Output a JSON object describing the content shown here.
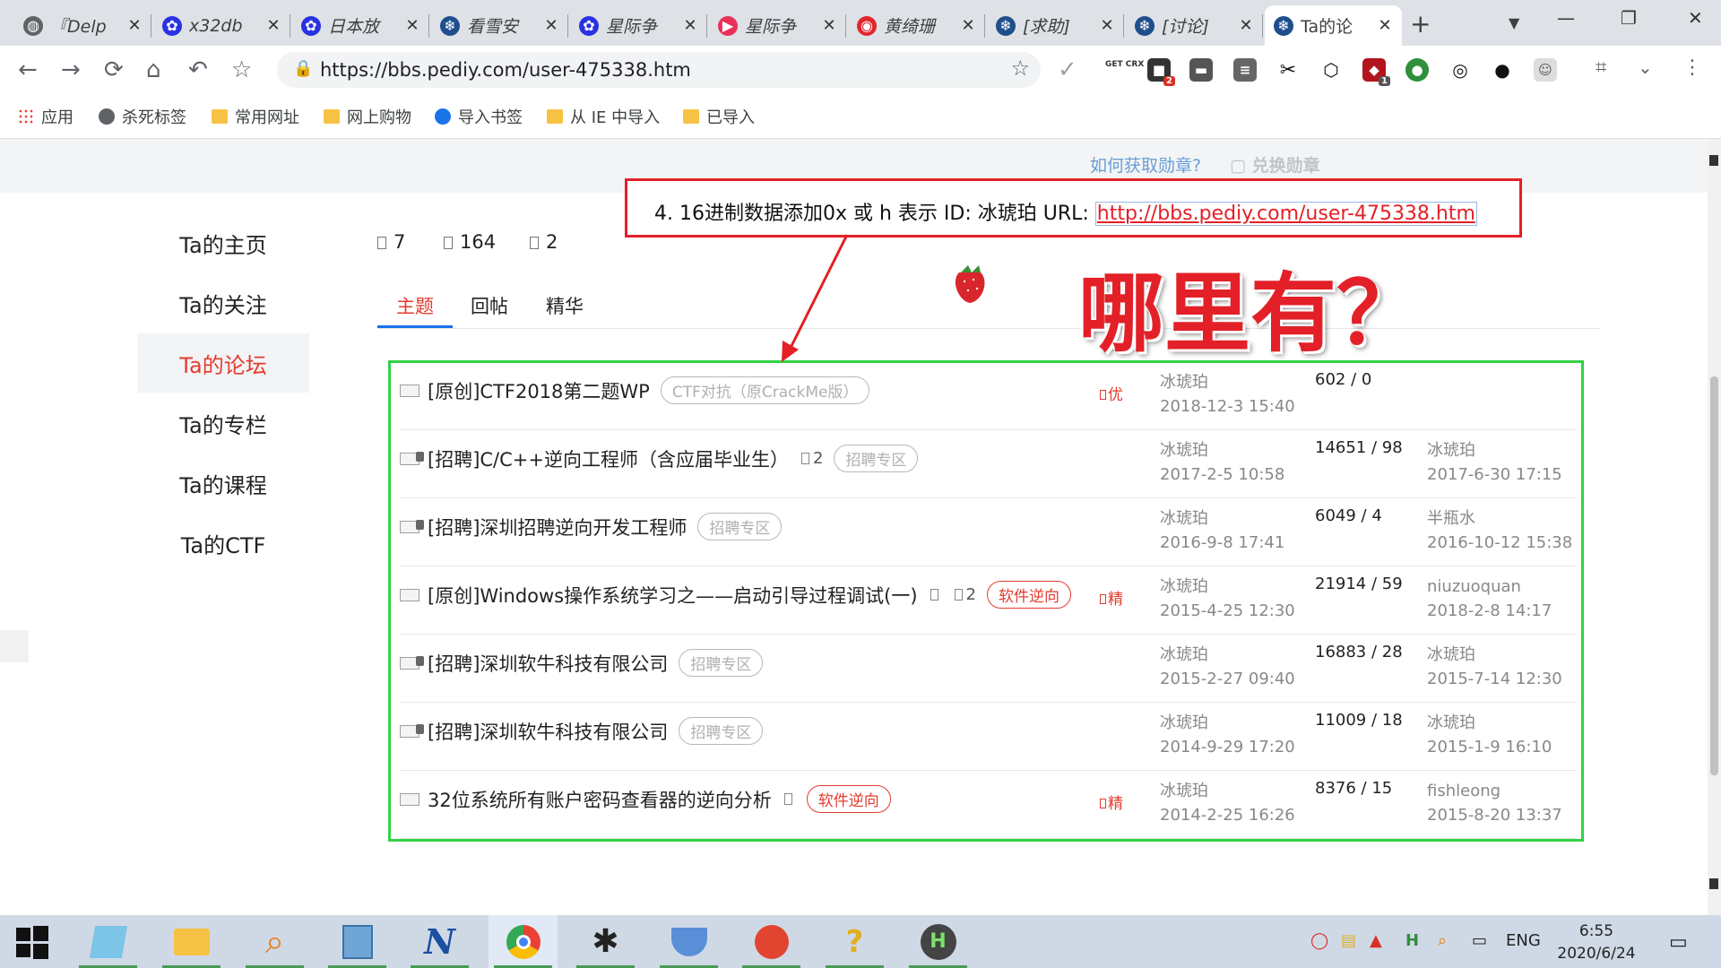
{
  "browser": {
    "tabs": [
      {
        "label": "『Delp",
        "icon": "globe-icon",
        "color": "#5f6368"
      },
      {
        "label": "x32db",
        "icon": "baidu-paw-icon",
        "color": "#2932e1"
      },
      {
        "label": "日本放",
        "icon": "baidu-paw-icon",
        "color": "#2932e1"
      },
      {
        "label": "看雪安",
        "icon": "snowflake-icon",
        "color": "#1f4e8c"
      },
      {
        "label": "星际争",
        "icon": "baidu-paw-icon",
        "color": "#2932e1"
      },
      {
        "label": "星际争",
        "icon": "video-play-icon",
        "color": "#e8305a"
      },
      {
        "label": "黄绮珊",
        "icon": "netease-music-icon",
        "color": "#e0262b"
      },
      {
        "label": "[求助]",
        "icon": "snowflake-icon",
        "color": "#1f4e8c"
      },
      {
        "label": "[讨论]",
        "icon": "snowflake-icon",
        "color": "#1f4e8c"
      },
      {
        "label": "Ta的论",
        "icon": "snowflake-icon",
        "color": "#1f4e8c",
        "active": true
      }
    ],
    "url": "https://bbs.pediy.com/user-475338.htm",
    "bookmarks": [
      "应用",
      "杀死标签",
      "常用网址",
      "网上购物",
      "导入书签",
      "从 IE 中导入",
      "已导入"
    ],
    "ext_getcrx": "GET CRX",
    "ext_badge_1": "2",
    "ext_badge_2": "1"
  },
  "page": {
    "medal_link": "如何获取勋章?",
    "exchange_link": "兑换勋章",
    "sidebar": [
      "Ta的主页",
      "Ta的关注",
      "Ta的论坛",
      "Ta的专栏",
      "Ta的课程",
      "Ta的CTF"
    ],
    "stats": [
      "7",
      "164",
      "2"
    ],
    "tabs": [
      "主题",
      "回帖",
      "精华"
    ],
    "threads": [
      {
        "title": "[原创]CTF2018第二题WP",
        "count": "",
        "tag": "CTF对抗（原CrackMe版）",
        "tag_red": false,
        "flag": "优",
        "author": "冰琥珀",
        "date": "2018-12-3 15:40",
        "stats": "602 / 0",
        "last_user": "",
        "last_date": "",
        "locked": false,
        "extra_sq": false
      },
      {
        "title": "[招聘]C/C++逆向工程师（含应届毕业生）",
        "count": "2",
        "tag": "招聘专区",
        "tag_red": false,
        "flag": "",
        "author": "冰琥珀",
        "date": "2017-2-5 10:58",
        "stats": "14651 / 98",
        "last_user": "冰琥珀",
        "last_date": "2017-6-30 17:15",
        "locked": true,
        "extra_sq": false
      },
      {
        "title": "[招聘]深圳招聘逆向开发工程师",
        "count": "",
        "tag": "招聘专区",
        "tag_red": false,
        "flag": "",
        "author": "冰琥珀",
        "date": "2016-9-8 17:41",
        "stats": "6049 / 4",
        "last_user": "半瓶水",
        "last_date": "2016-10-12 15:38",
        "locked": true,
        "extra_sq": false
      },
      {
        "title": "[原创]Windows操作系统学习之——启动引导过程调试(一)",
        "count": "2",
        "tag": "软件逆向",
        "tag_red": true,
        "flag": "精",
        "author": "冰琥珀",
        "date": "2015-4-25 12:30",
        "stats": "21914 / 59",
        "last_user": "niuzuoquan",
        "last_date": "2018-2-8 14:17",
        "locked": false,
        "extra_sq": true
      },
      {
        "title": "[招聘]深圳软牛科技有限公司",
        "count": "",
        "tag": "招聘专区",
        "tag_red": false,
        "flag": "",
        "author": "冰琥珀",
        "date": "2015-2-27 09:40",
        "stats": "16883 / 28",
        "last_user": "冰琥珀",
        "last_date": "2015-7-14 12:30",
        "locked": true,
        "extra_sq": false
      },
      {
        "title": "[招聘]深圳软牛科技有限公司",
        "count": "",
        "tag": "招聘专区",
        "tag_red": false,
        "flag": "",
        "author": "冰琥珀",
        "date": "2014-9-29 17:20",
        "stats": "11009 / 18",
        "last_user": "冰琥珀",
        "last_date": "2015-1-9 16:10",
        "locked": true,
        "extra_sq": false
      },
      {
        "title": "32位系统所有账户密码查看器的逆向分析",
        "count": "",
        "tag": "软件逆向",
        "tag_red": true,
        "flag": "精",
        "author": "冰琥珀",
        "date": "2014-2-25 16:26",
        "stats": "8376 / 15",
        "last_user": "fishleong",
        "last_date": "2015-8-20 13:37",
        "locked": false,
        "extra_sq": true
      }
    ]
  },
  "annotation": {
    "text": "4. 16进制数据添加0x 或 h 表示 ID: 冰琥珀 URL: ",
    "url": "http://bbs.pediy.com/user-475338.htm",
    "question": "哪里有？"
  },
  "taskbar": {
    "lang": "ENG",
    "time": "6:55",
    "date": "2020/6/24"
  },
  "colors": {
    "accent_red": "#e43b2d",
    "annotation_red": "#e32028",
    "annotation_green": "#33d145",
    "link_blue": "#6a9ed6"
  }
}
